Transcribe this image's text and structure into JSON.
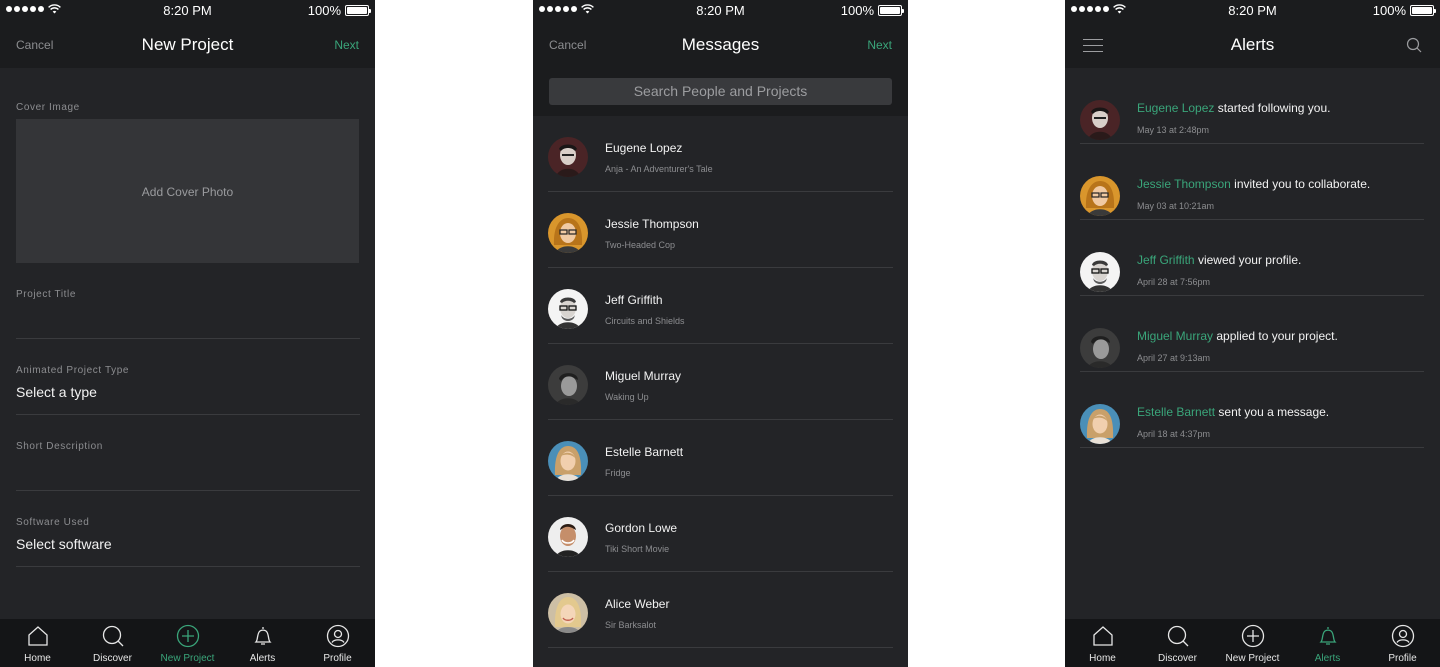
{
  "colors": {
    "accent": "#3aa57a",
    "background": "#232427",
    "header": "#1b1c1e"
  },
  "status": {
    "time": "8:20 PM",
    "battery": "100%"
  },
  "new_project": {
    "cancel": "Cancel",
    "title": "New Project",
    "next": "Next",
    "cover_label": "Cover Image",
    "cover_placeholder": "Add Cover Photo",
    "project_title_label": "Project Title",
    "type_label": "Animated Project Type",
    "type_value": "Select a type",
    "description_label": "Short Description",
    "software_label": "Software Used",
    "software_value": "Select software"
  },
  "messages": {
    "cancel": "Cancel",
    "title": "Messages",
    "next": "Next",
    "search_placeholder": "Search People and Projects",
    "items": [
      {
        "name": "Eugene Lopez",
        "project": "Anja - An Adventurer's Tale",
        "avatar": "avatar-eugene"
      },
      {
        "name": "Jessie Thompson",
        "project": "Two-Headed Cop",
        "avatar": "avatar-jessie"
      },
      {
        "name": "Jeff Griffith",
        "project": "Circuits and Shields",
        "avatar": "avatar-jeff"
      },
      {
        "name": "Miguel Murray",
        "project": "Waking Up",
        "avatar": "avatar-miguel"
      },
      {
        "name": "Estelle Barnett",
        "project": "Fridge",
        "avatar": "avatar-estelle"
      },
      {
        "name": "Gordon Lowe",
        "project": "Tiki Short Movie",
        "avatar": "avatar-gordon"
      },
      {
        "name": "Alice Weber",
        "project": "Sir Barksalot",
        "avatar": "avatar-alice"
      }
    ]
  },
  "alerts": {
    "title": "Alerts",
    "items": [
      {
        "who": "Eugene Lopez",
        "action": "started following you.",
        "when": "May 13 at 2:48pm"
      },
      {
        "who": "Jessie Thompson",
        "action": "invited you to collaborate.",
        "when": "May 03 at 10:21am"
      },
      {
        "who": "Jeff Griffith",
        "action": "viewed your profile.",
        "when": "April 28 at 7:56pm"
      },
      {
        "who": "Miguel Murray",
        "action": "applied to your project.",
        "when": "April 27 at 9:13am"
      },
      {
        "who": "Estelle Barnett",
        "action": "sent you a message.",
        "when": "April 18 at 4:37pm"
      }
    ]
  },
  "tabs": [
    {
      "label": "Home",
      "icon": "home-icon"
    },
    {
      "label": "Discover",
      "icon": "search-icon"
    },
    {
      "label": "New Project",
      "icon": "plus-circle-icon"
    },
    {
      "label": "Alerts",
      "icon": "bell-icon"
    },
    {
      "label": "Profile",
      "icon": "user-icon"
    }
  ]
}
